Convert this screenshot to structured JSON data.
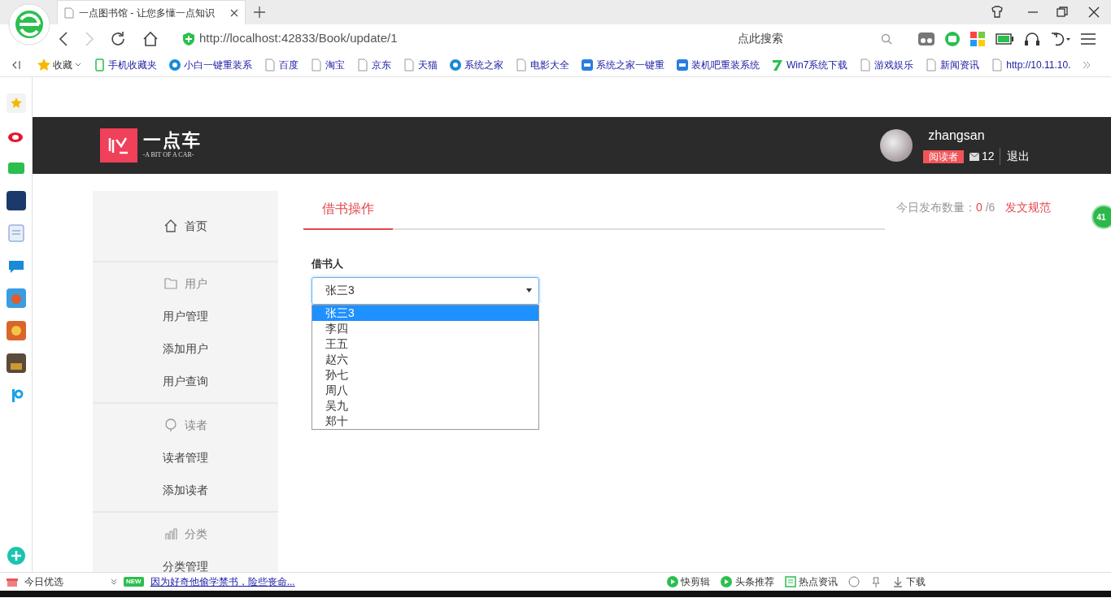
{
  "browser": {
    "tab_title": "一点图书馆 - 让您多懂一点知识",
    "url": "http://localhost:42833/Book/update/1",
    "search_placeholder": "点此搜索",
    "bookmarks": [
      {
        "label": "收藏",
        "kind": "star"
      },
      {
        "label": "手机收藏夹",
        "kind": "phone"
      },
      {
        "label": "小白一键重装系",
        "kind": "round"
      },
      {
        "label": "百度",
        "kind": "page"
      },
      {
        "label": "淘宝",
        "kind": "page"
      },
      {
        "label": "京东",
        "kind": "page"
      },
      {
        "label": "天猫",
        "kind": "page"
      },
      {
        "label": "系统之家",
        "kind": "round"
      },
      {
        "label": "电影大全",
        "kind": "page"
      },
      {
        "label": "系统之家一键重",
        "kind": "square"
      },
      {
        "label": "装机吧重装系统",
        "kind": "square"
      },
      {
        "label": "Win7系统下载",
        "kind": "seven"
      },
      {
        "label": "游戏娱乐",
        "kind": "page"
      },
      {
        "label": "新闻资讯",
        "kind": "page"
      },
      {
        "label": "http://10.11.10.",
        "kind": "page"
      }
    ]
  },
  "header": {
    "brand": "一点车",
    "tagline": "-A BIT OF A CAR-",
    "user": {
      "name": "zhangsan",
      "role": "阅读者",
      "messages": "12",
      "logout": "退出"
    }
  },
  "sidebar": [
    {
      "title": "首页",
      "kind": "home"
    },
    {
      "title": "用户",
      "kind": "folder",
      "items": [
        "用户管理",
        "添加用户",
        "用户查询"
      ]
    },
    {
      "title": "读者",
      "kind": "reader",
      "items": [
        "读者管理",
        "添加读者"
      ]
    },
    {
      "title": "分类",
      "kind": "chart",
      "items": [
        "分类管理"
      ]
    }
  ],
  "tabs": [
    {
      "label": "借书操作",
      "selected": true
    }
  ],
  "stats": {
    "label": "今日发布数量：",
    "count": "0",
    "total": " /6",
    "rules_link": "发文规范"
  },
  "form": {
    "label": "借书人",
    "value": "张三3",
    "options": [
      {
        "label": "张三3",
        "selected": true
      },
      {
        "label": "李四",
        "selected": false
      },
      {
        "label": "王五",
        "selected": false
      },
      {
        "label": "赵六",
        "selected": false
      },
      {
        "label": "孙七",
        "selected": false
      },
      {
        "label": "周八",
        "selected": false
      },
      {
        "label": "吴九",
        "selected": false
      },
      {
        "label": "郑十",
        "selected": false
      }
    ]
  },
  "floating_badge": "41",
  "status_bar": {
    "left": "今日优选",
    "news_tag": "NEW",
    "news": "因为好奇他偷学禁书，险些丧命...",
    "right": [
      "快剪辑",
      "头条推荐",
      "热点资讯",
      "下载"
    ]
  }
}
